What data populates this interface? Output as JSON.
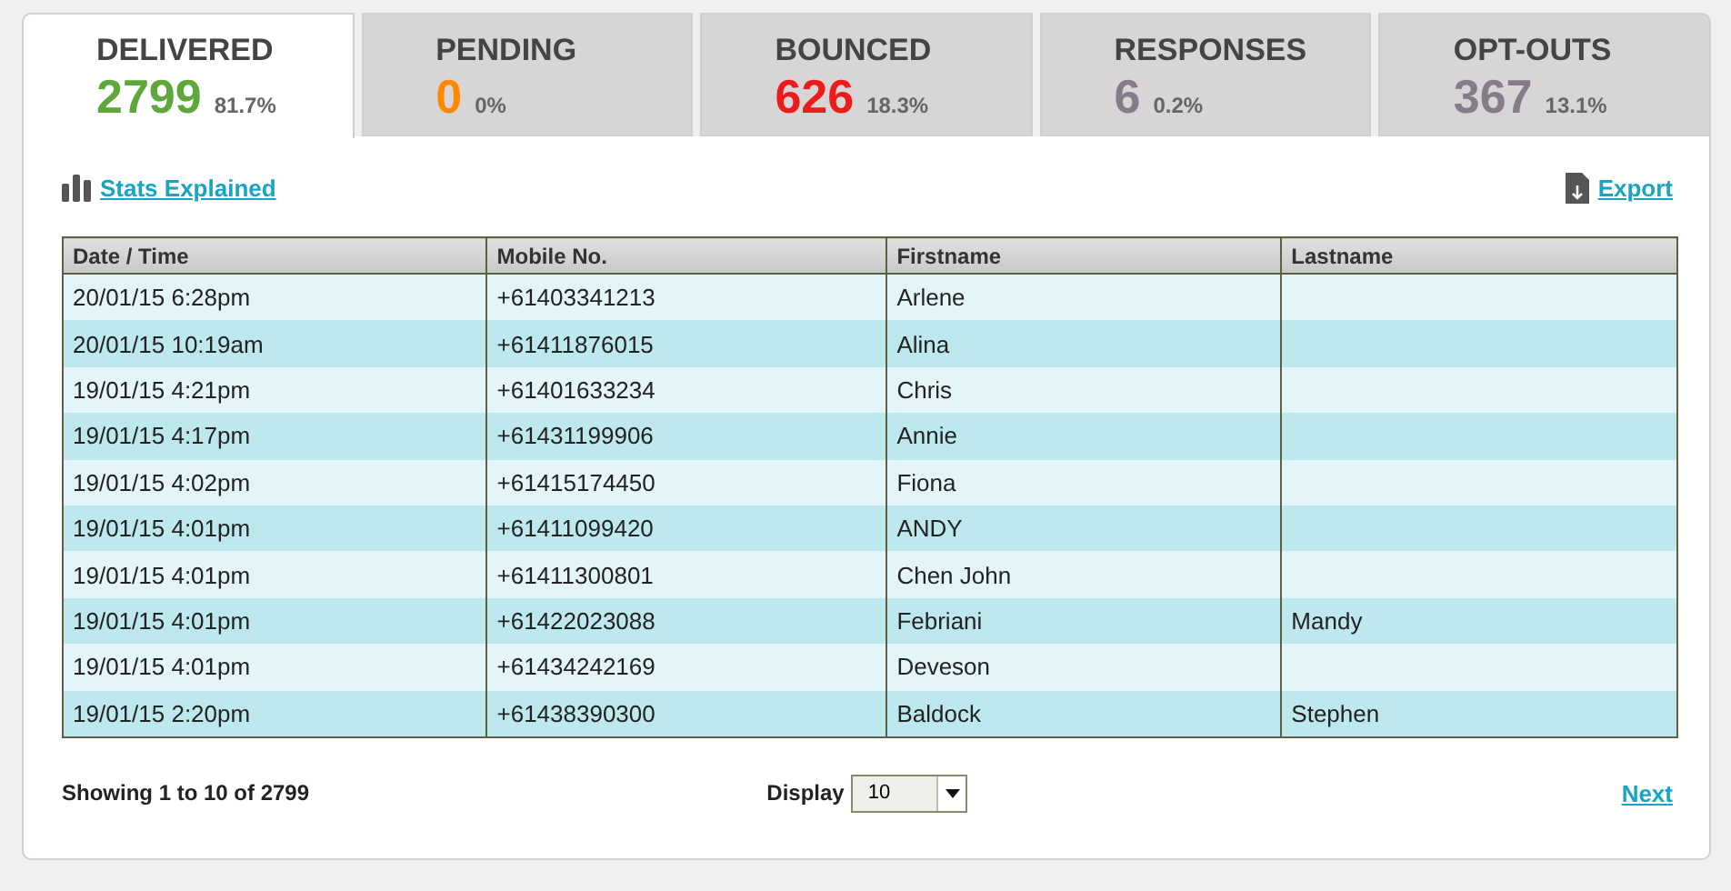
{
  "tabs": [
    {
      "label": "DELIVERED",
      "count": "2799",
      "percent": "81.7%",
      "color": "#5ea83a",
      "selected": true
    },
    {
      "label": "PENDING",
      "count": "0",
      "percent": "0%",
      "color": "#ff8a00",
      "selected": false
    },
    {
      "label": "BOUNCED",
      "count": "626",
      "percent": "18.3%",
      "color": "#ee1b1b",
      "selected": false
    },
    {
      "label": "RESPONSES",
      "count": "6",
      "percent": "0.2%",
      "color": "#867b89",
      "selected": false
    },
    {
      "label": "OPT-OUTS",
      "count": "367",
      "percent": "13.1%",
      "color": "#867b89",
      "selected": false
    }
  ],
  "links": {
    "stats": "Stats Explained",
    "export": "Export"
  },
  "table": {
    "columns": [
      "Date / Time",
      "Mobile No.",
      "Firstname",
      "Lastname"
    ],
    "rows": [
      [
        "20/01/15 6:28pm",
        "+61403341213",
        "Arlene",
        ""
      ],
      [
        "20/01/15 10:19am",
        "+61411876015",
        "Alina",
        ""
      ],
      [
        "19/01/15 4:21pm",
        "+61401633234",
        "Chris",
        ""
      ],
      [
        "19/01/15 4:17pm",
        "+61431199906",
        "Annie",
        ""
      ],
      [
        "19/01/15 4:02pm",
        "+61415174450",
        "Fiona",
        ""
      ],
      [
        "19/01/15 4:01pm",
        "+61411099420",
        "ANDY",
        ""
      ],
      [
        "19/01/15 4:01pm",
        "+61411300801",
        "Chen John",
        ""
      ],
      [
        "19/01/15 4:01pm",
        "+61422023088",
        "Febriani",
        "Mandy"
      ],
      [
        "19/01/15 4:01pm",
        "+61434242169",
        "Deveson",
        ""
      ],
      [
        "19/01/15 2:20pm",
        "+61438390300",
        "Baldock",
        "Stephen"
      ]
    ]
  },
  "footer": {
    "showing": "Showing 1 to 10 of 2799",
    "display_label": "Display",
    "display_value": "10",
    "next": "Next"
  }
}
